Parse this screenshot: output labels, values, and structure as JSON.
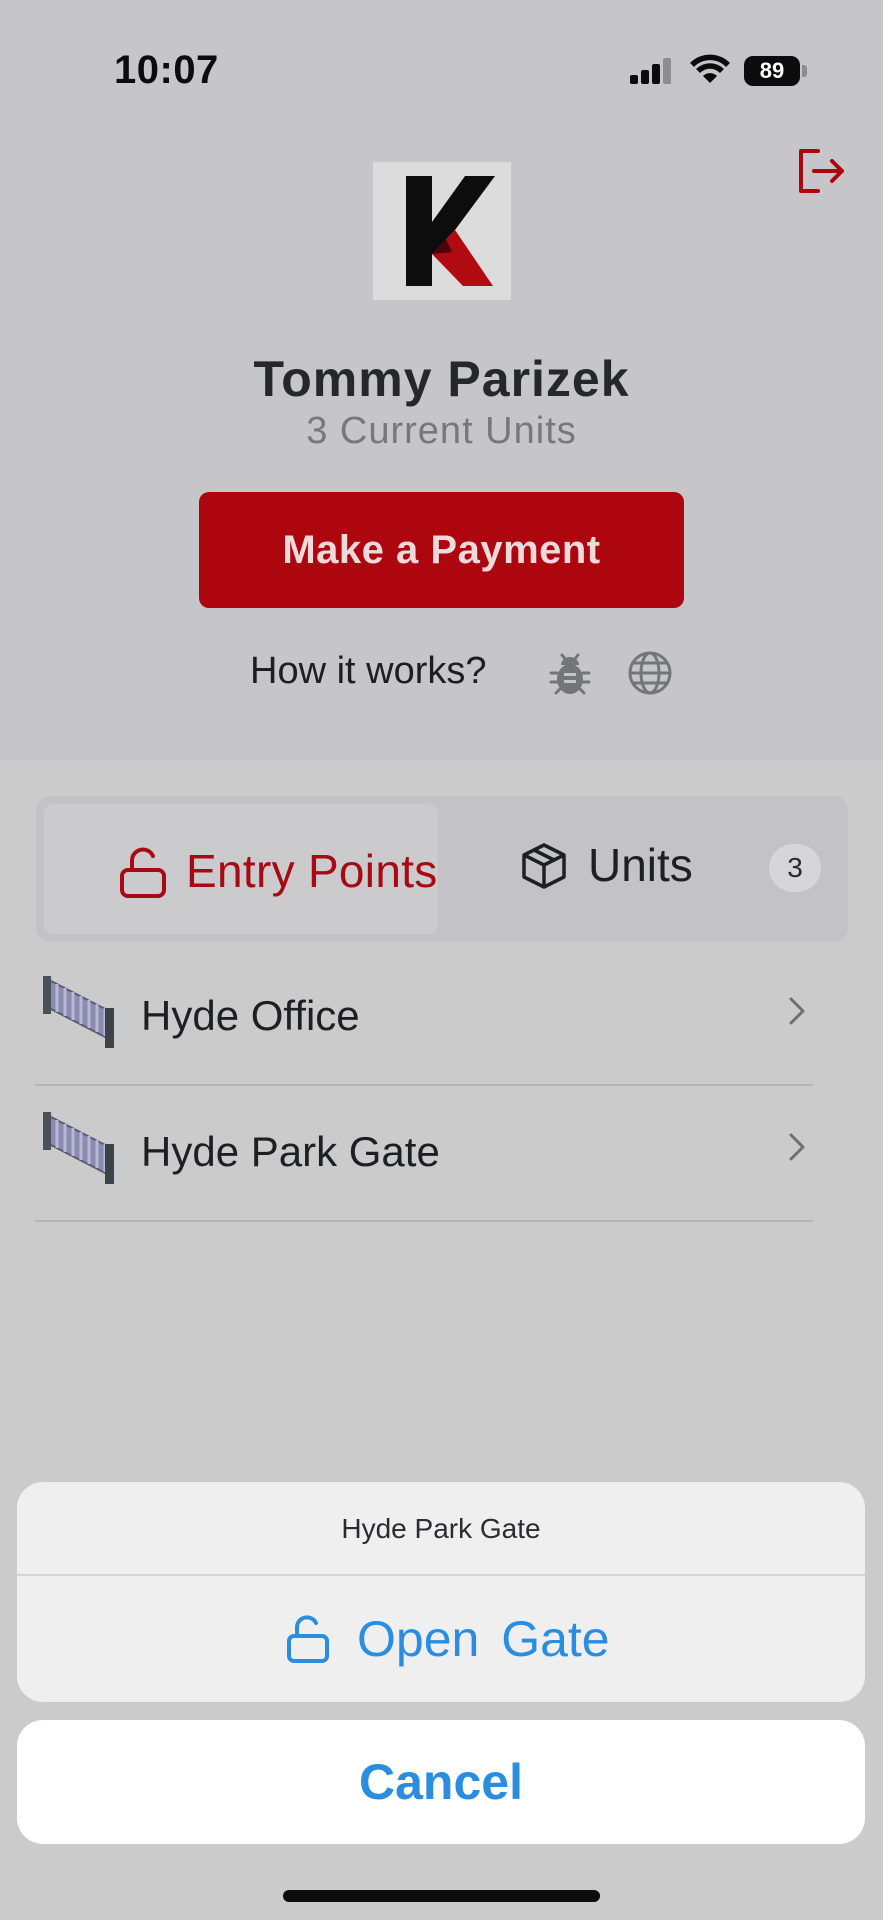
{
  "status_bar": {
    "time": "10:07",
    "battery": "89"
  },
  "header": {
    "logo_letter": "K",
    "user_name": "Tommy Parizek",
    "units_text": "3 Current Units",
    "pay_button_label": "Make a Payment",
    "how_it_works_label": "How it works?"
  },
  "tabs": {
    "entry_points_label": "Entry Points",
    "units_label": "Units",
    "units_count": "3"
  },
  "entry_points": [
    {
      "name": "Hyde Office"
    },
    {
      "name": "Hyde Park Gate"
    }
  ],
  "action_sheet": {
    "title": "Hyde Park Gate",
    "action_label": "Open Gate",
    "cancel_label": "Cancel"
  },
  "colors": {
    "brand_red": "#ae060f",
    "action_blue": "#2b8de0"
  },
  "icons": {
    "logout": "logout-icon",
    "bug": "bug-icon",
    "globe": "globe-icon",
    "entry_points": "unlock-icon",
    "units": "box-icon",
    "gate": "gate-icon",
    "chevron": "chevron-right-icon"
  }
}
